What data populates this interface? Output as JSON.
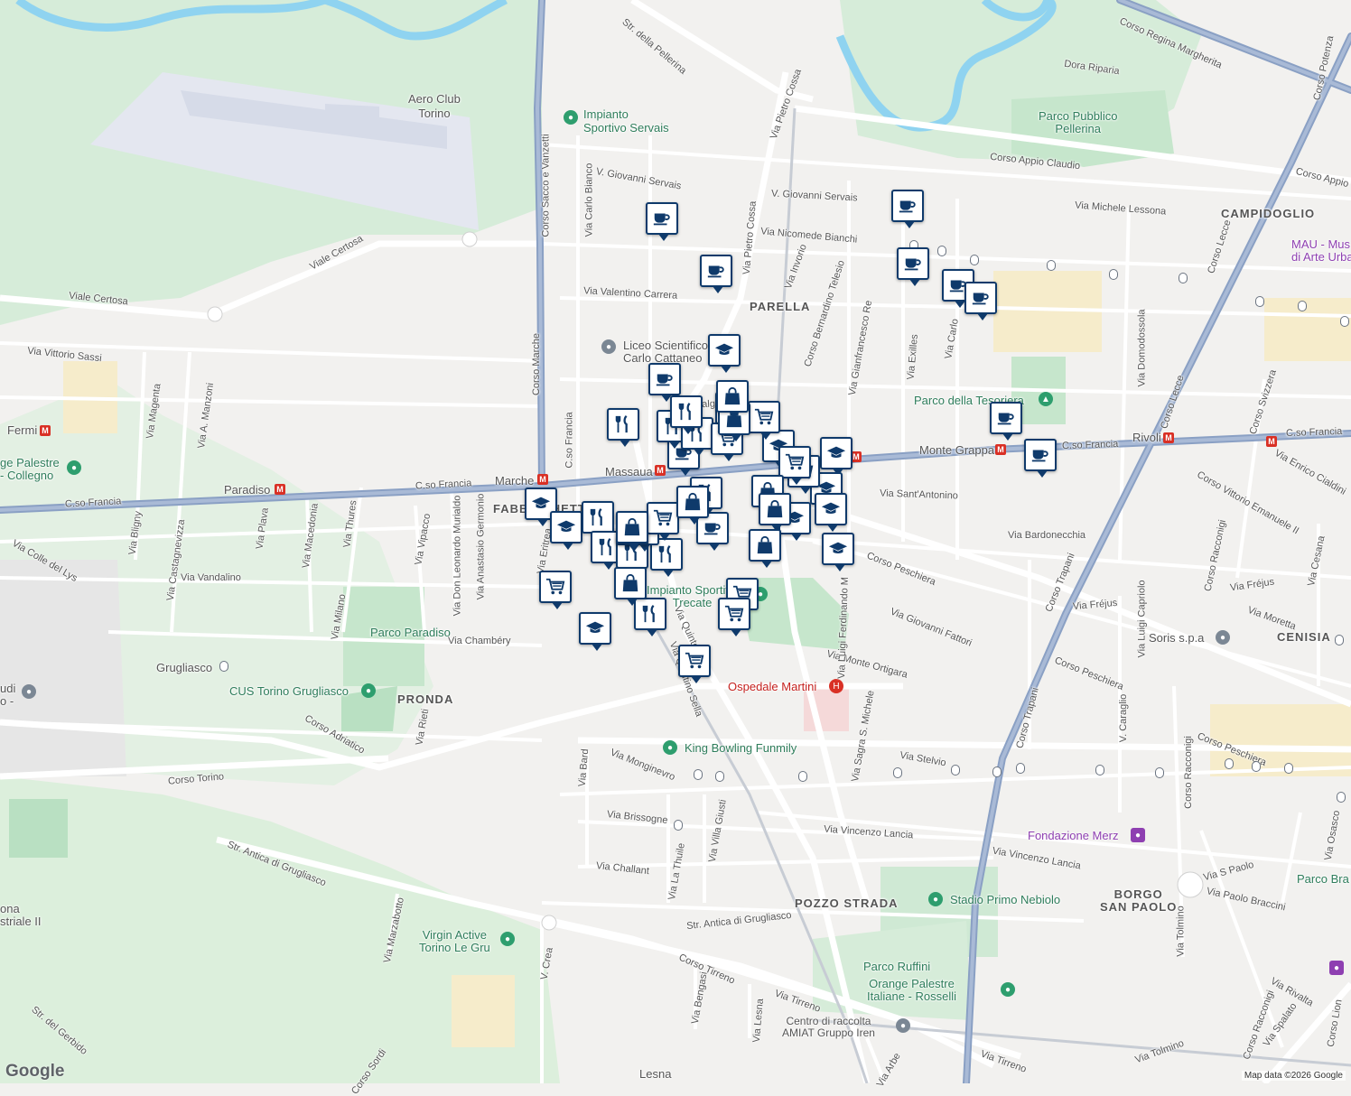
{
  "map": {
    "attribution": "Map data ©2026 Google",
    "logo": "Google",
    "colors": {
      "marker_border": "#0f3a6b",
      "marker_icon": "#0f3a6b",
      "park_fill": "#cfe9d4",
      "water": "#8fd3f0",
      "arterial": "#8aa0c4",
      "road": "#ffffff"
    }
  },
  "labels": {
    "aero_club": "Aero Club\nTorino",
    "impianto_servais": "Impianto\nSportivo Servais",
    "liceo": "Liceo Scientifico\nCarlo Cattaneo",
    "parco_pellerina": "Parco Pubblico\nPellerina",
    "dora": "Dora Riparia",
    "campidoglio": "CAMPIDOGLIO",
    "mau": "MAU - Mus\ndi Arte Urba",
    "parella": "PARELLA",
    "tesoriera": "Parco della Tesoriera",
    "fermi": "Fermi",
    "palestre_collegno": "ge Palestre\n- Collegno",
    "paradiso": "Paradiso",
    "marche": "Marche",
    "massaua": "Massaua",
    "monte_grappa": "Monte Grappa",
    "rivoli": "Rivoli",
    "fabbrichetta": "FABBRICHETTA",
    "parco_paradiso": "Parco Paradiso",
    "grugliasco": "Grugliasco",
    "cus": "CUS Torino Grugliasco",
    "pronda": "PRONDA",
    "impianto_trecate": "Impianto Sportivo\nTrecate",
    "ospedale": "Ospedale Martini",
    "king_bowling": "King Bowling Funmily",
    "soris": "Soris s.p.a",
    "cenisia": "CENISIA",
    "fondazione_merz": "Fondazione Merz",
    "pozzo_strada": "POZZO STRADA",
    "stadio": "Stadio Primo Nebiolo",
    "borgo_san_paolo": "BORGO\nSAN PAOLO",
    "parco_ruffini": "Parco Ruffini",
    "orange_rosselli": "Orange Palestre\nItaliane - Rosselli",
    "virgin": "Virgin Active\nTorino Le Gru",
    "amiat": "Centro di raccolta\nAMIAT Gruppo Iren",
    "lesna": "Lesna",
    "parco_bra": "Parco Bra",
    "industriale": "ona\nstriale II",
    "udi": "udi\no -"
  },
  "streets": [
    "Corso Regina Margherita",
    "Corso Appio Claudio",
    "Via Michele Lessona",
    "Corso Sacco e Vanzetti",
    "Str. della Pellerina",
    "Via Pietro Cossa",
    "V. Giovanni Servais",
    "V. Giovanni Servais",
    "Via Nicomede Bianchi",
    "Via Carlo Bianco",
    "Viale Certosa",
    "Viale Certosa",
    "Via Valentino Carrera",
    "Corso Marche",
    "Via Vittorio Sassi",
    "Via Magenta",
    "Via A. Manzoni",
    "C.so Francia",
    "C.so Francia",
    "C.so Francia",
    "C.so Francia",
    "Via Valgioie",
    "Via Bardonecchia",
    "Via Sant'Antonino",
    "Corso Peschiera",
    "Corso Peschiera",
    "Corso Peschiera",
    "Via Vandalino",
    "Via Chambéry",
    "Via Don Leonardo Murialdo",
    "Via Anastasio Germonio",
    "Via Thures",
    "Via Macedonia",
    "Via Plava",
    "Via Castagnevizza",
    "Via Bligny",
    "Via Colle del Lys",
    "Via Milano",
    "Via Rieti",
    "Via Vipacco",
    "Via Eritrea",
    "Corso Adriatico",
    "Corso Torino",
    "Via Monginevro",
    "Via Bard",
    "Via Brissogne",
    "Via Challant",
    "Via La Thuile",
    "Via Villa Giusti",
    "Str. Antica di Grugliasco",
    "Str. Antica di Grugliasco",
    "Corso Tirreno",
    "Via Tirreno",
    "Via Tirreno",
    "Via Bengasi",
    "Via Lesna",
    "Via Arbe",
    "Via Marzabotto",
    "V. Crea",
    "Str. del Gerbido",
    "Corso Sordi",
    "Via Stelvio",
    "Via Vincenzo Lancia",
    "Via Vincenzo Lancia",
    "Via Giovanni Fattori",
    "Via Monte Ortigara",
    "Via Sagra S. Michele",
    "Via Luigi Ferdinando M",
    "Corso Trapani",
    "Corso Trapani",
    "Corso Racconigi",
    "Corso Racconigi",
    "Corso Racconigi",
    "Via Fréjus",
    "Via Fréjus",
    "Via Luigi Capriolo",
    "V. Caraglio",
    "Via Moretta",
    "Via Cesana",
    "Corso Vittorio Emanuele II",
    "Via Enrico Cialdini",
    "Corso Svizzera",
    "Corso Lecce",
    "Corso Lecce",
    "Via Domodossola",
    "Via Exilles",
    "Via Carlo",
    "Via Gianfrancesco Re",
    "Corso Bernardino Telesio",
    "Via Invorio",
    "C.so Francia",
    "Via Pietro Cossa",
    "Corso Appio",
    "Corso Potenza",
    "Via S Paolo",
    "Via Paolo Braccini",
    "Via Tolmino",
    "Via Tolmino",
    "Via Rivalta",
    "Via Spalato",
    "Corso Lion",
    "Via Osasco",
    "Via Quinto",
    "Via Quintino Sella"
  ],
  "markers": [
    {
      "type": "cafe-icon"
    },
    {
      "type": "cafe-icon"
    },
    {
      "type": "cafe-icon"
    },
    {
      "type": "cafe-icon"
    },
    {
      "type": "cafe-icon"
    },
    {
      "type": "cafe-icon"
    },
    {
      "type": "cafe-icon"
    },
    {
      "type": "cafe-icon"
    },
    {
      "type": "cafe-icon"
    },
    {
      "type": "cafe-icon"
    },
    {
      "type": "cafe-icon"
    },
    {
      "type": "school-icon"
    },
    {
      "type": "school-icon"
    },
    {
      "type": "school-icon"
    },
    {
      "type": "school-icon"
    },
    {
      "type": "school-icon"
    },
    {
      "type": "school-icon"
    },
    {
      "type": "school-icon"
    },
    {
      "type": "school-icon"
    },
    {
      "type": "school-icon"
    },
    {
      "type": "school-icon"
    },
    {
      "type": "restaurant-icon"
    },
    {
      "type": "restaurant-icon"
    },
    {
      "type": "restaurant-icon"
    },
    {
      "type": "restaurant-icon"
    },
    {
      "type": "restaurant-icon"
    },
    {
      "type": "restaurant-icon"
    },
    {
      "type": "restaurant-icon"
    },
    {
      "type": "restaurant-icon"
    },
    {
      "type": "restaurant-icon"
    },
    {
      "type": "restaurant-icon"
    },
    {
      "type": "restaurant-icon"
    },
    {
      "type": "grocery-icon"
    },
    {
      "type": "grocery-icon"
    },
    {
      "type": "grocery-icon"
    },
    {
      "type": "grocery-icon"
    },
    {
      "type": "grocery-icon"
    },
    {
      "type": "grocery-icon"
    },
    {
      "type": "grocery-icon"
    },
    {
      "type": "grocery-icon"
    },
    {
      "type": "grocery-icon"
    },
    {
      "type": "grocery-icon"
    },
    {
      "type": "grocery-icon"
    },
    {
      "type": "shopping-icon"
    },
    {
      "type": "shopping-icon"
    },
    {
      "type": "shopping-icon"
    },
    {
      "type": "shopping-icon"
    },
    {
      "type": "shopping-icon"
    },
    {
      "type": "shopping-icon"
    },
    {
      "type": "shopping-icon"
    },
    {
      "type": "shopping-icon"
    }
  ]
}
